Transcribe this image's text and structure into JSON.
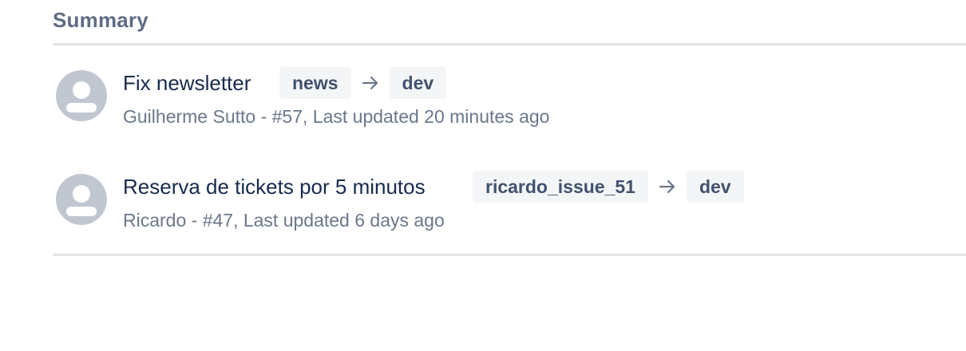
{
  "summary": {
    "title": "Summary"
  },
  "pull_requests": [
    {
      "title": "Fix newsletter",
      "source_branch": "news",
      "target_branch": "dev",
      "meta": "Guilherme Sutto - #57, Last updated 20 minutes ago",
      "avatar_icon": "default-user-avatar-icon",
      "arrow_icon": "arrow-right-icon"
    },
    {
      "title": "Reserva de tickets por 5 minutos",
      "source_branch": "ricardo_issue_51",
      "target_branch": "dev",
      "meta": "Ricardo - #47, Last updated 6 days ago",
      "avatar_icon": "default-user-avatar-icon",
      "arrow_icon": "arrow-right-icon"
    }
  ],
  "colors": {
    "heading": "#5e6c84",
    "title_text": "#172b4d",
    "meta_text": "#6b778c",
    "lozenge_bg": "#f4f5f7",
    "lozenge_text": "#42526e",
    "divider": "#e3e4e8",
    "avatar_bg": "#c1c7d0"
  }
}
